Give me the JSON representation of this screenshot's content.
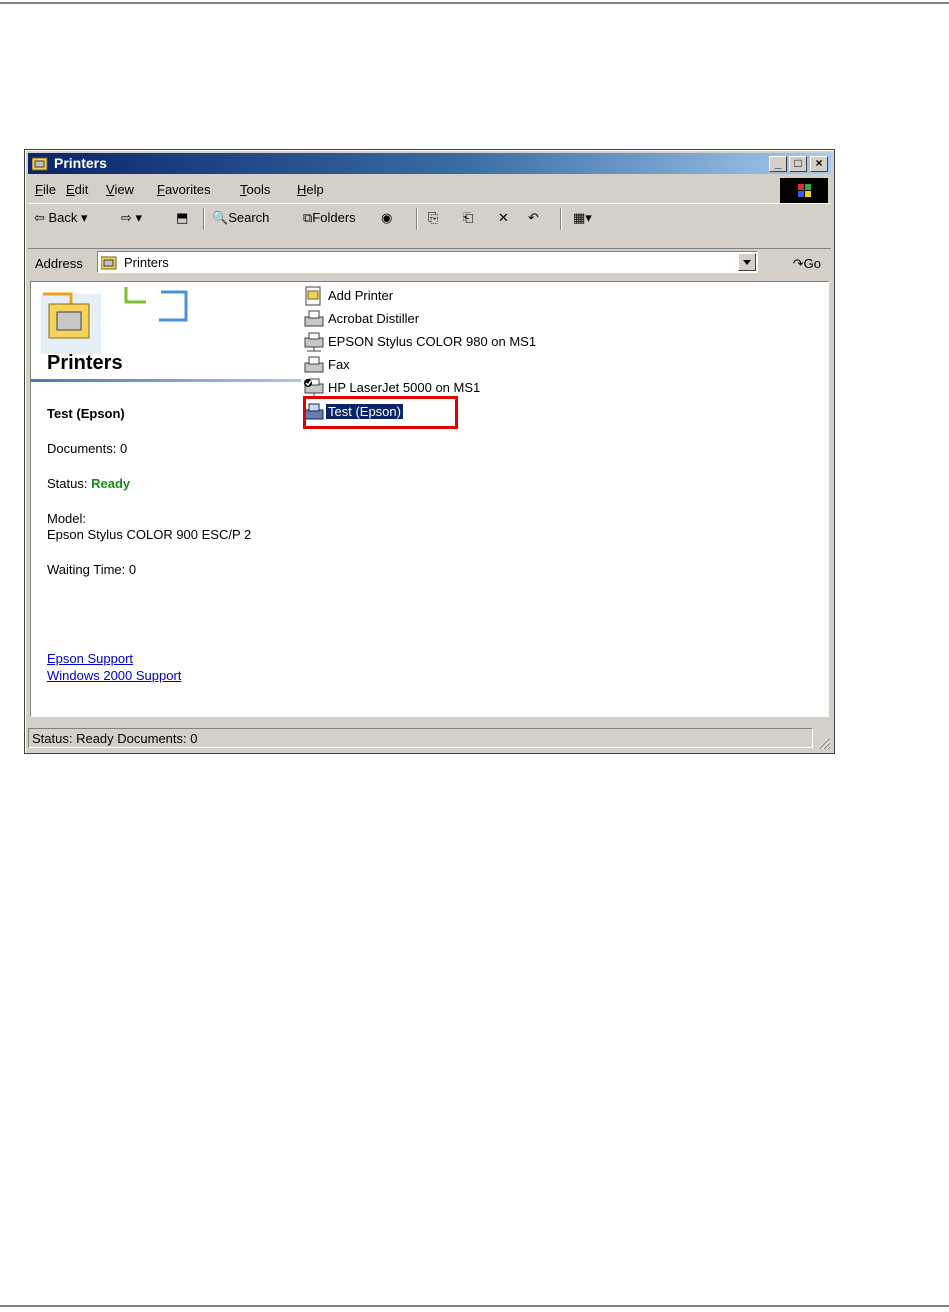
{
  "window": {
    "title": "Printers"
  },
  "menu": [
    "File",
    "Edit",
    "View",
    "Favorites",
    "Tools",
    "Help"
  ],
  "toolbar": {
    "back": "Back",
    "search": "Search",
    "folders": "Folders"
  },
  "address": {
    "label": "Address",
    "value": "Printers",
    "go": "Go"
  },
  "panel": {
    "title": "Printers",
    "selected_name": "Test (Epson)",
    "documents": "Documents: 0",
    "status_label": "Status:",
    "status_value": "Ready",
    "model_label": "Model:",
    "model_value": "Epson Stylus COLOR 900 ESC/P 2",
    "waiting": "Waiting Time: 0",
    "links": [
      "Epson Support",
      "Windows 2000 Support"
    ]
  },
  "printers": [
    {
      "name": "Add Printer",
      "icon": "add-printer-icon",
      "selected": false
    },
    {
      "name": "Acrobat Distiller",
      "icon": "printer-icon",
      "selected": false
    },
    {
      "name": "EPSON Stylus COLOR 980 on MS1",
      "icon": "network-printer-icon",
      "selected": false
    },
    {
      "name": "Fax",
      "icon": "fax-icon",
      "selected": false
    },
    {
      "name": "HP LaserJet 5000 on MS1",
      "icon": "default-network-printer-icon",
      "selected": false
    },
    {
      "name": "Test (Epson)",
      "icon": "printer-icon",
      "selected": true
    }
  ],
  "statusbar": {
    "text": "Status: Ready Documents: 0"
  },
  "colors": {
    "titlebar": "#0a246a",
    "selection": "#0a246a",
    "ready": "#1a8a1a",
    "callout": "#e00000"
  }
}
